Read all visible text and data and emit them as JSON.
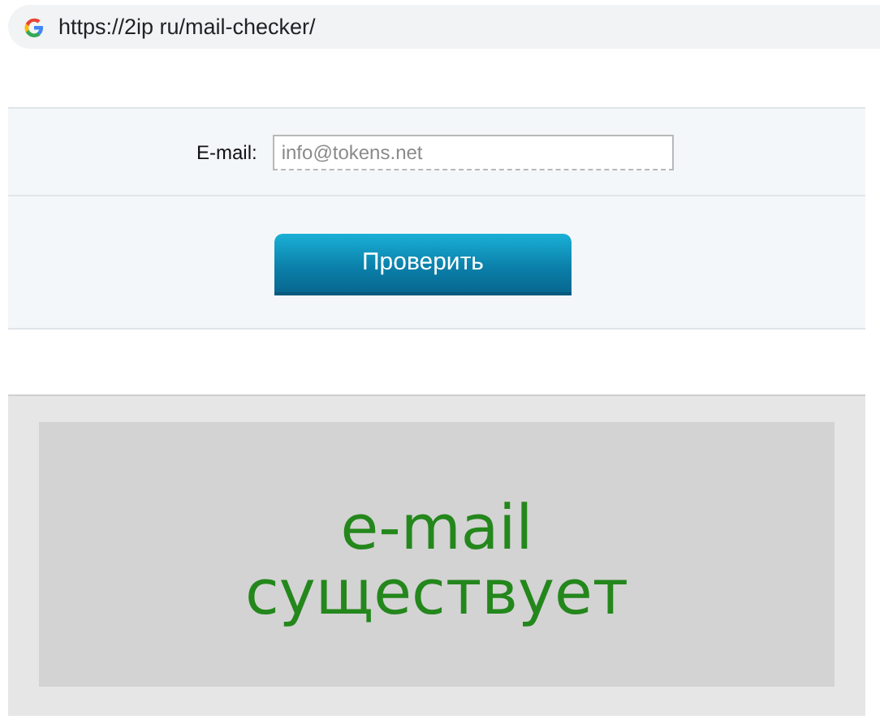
{
  "address_bar": {
    "url": "https://2ip ru/mail-checker/"
  },
  "form": {
    "label": "E-mail:",
    "placeholder": "info@tokens.net",
    "button": "Проверить"
  },
  "result": {
    "message": "e-mail существует"
  }
}
